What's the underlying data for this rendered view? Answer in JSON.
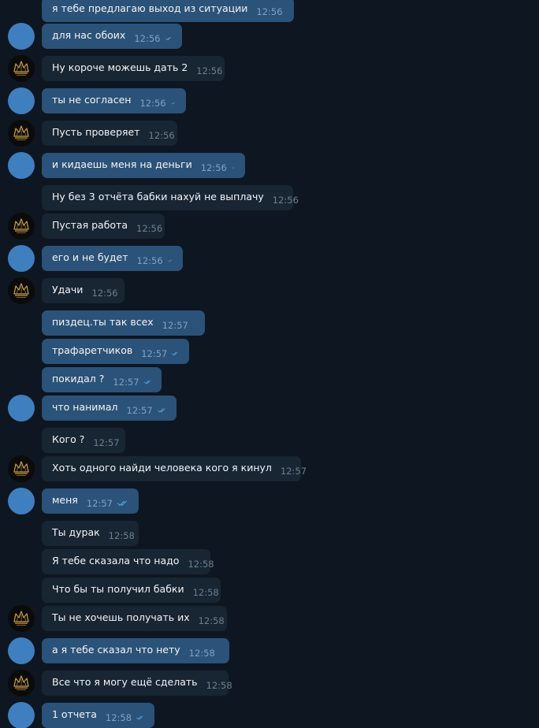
{
  "colors": {
    "background": "#0e1621",
    "outgoing_bubble": "#2b5278",
    "incoming_bubble": "#182533",
    "read_check": "#5ab3f0"
  },
  "messages": [
    {
      "text": "я тебе предлагаю выход из ситуации",
      "time": "12:56",
      "dir": "out",
      "avatar": false,
      "check": true
    },
    {
      "text": "для нас обоих",
      "time": "12:56",
      "dir": "out",
      "avatar": true,
      "check": true
    },
    {
      "text": "Ну короче можешь дать 2",
      "time": "12:56",
      "dir": "in",
      "avatar": true,
      "check": false
    },
    {
      "text": "ты не согласен",
      "time": "12:56",
      "dir": "out",
      "avatar": true,
      "check": true
    },
    {
      "text": "Пусть проверяет",
      "time": "12:56",
      "dir": "in",
      "avatar": true,
      "check": false
    },
    {
      "text": "и кидаешь меня на деньги",
      "time": "12:56",
      "dir": "out",
      "avatar": true,
      "check": true
    },
    {
      "text": "Ну без 3 отчёта бабки нахуй не выплачу",
      "time": "12:56",
      "dir": "in",
      "avatar": false,
      "check": false
    },
    {
      "text": "Пустая работа",
      "time": "12:56",
      "dir": "in",
      "avatar": true,
      "check": false
    },
    {
      "text": "его и не будет",
      "time": "12:56",
      "dir": "out",
      "avatar": true,
      "check": true
    },
    {
      "text": "Удачи",
      "time": "12:56",
      "dir": "in",
      "avatar": true,
      "check": false
    },
    {
      "text": "пиздец.ты так всех",
      "time": "12:57",
      "dir": "out",
      "avatar": false,
      "check": true
    },
    {
      "text": "трафаретчиков",
      "time": "12:57",
      "dir": "out",
      "avatar": false,
      "check": true
    },
    {
      "text": "покидал ?",
      "time": "12:57",
      "dir": "out",
      "avatar": false,
      "check": true
    },
    {
      "text": "что нанимал",
      "time": "12:57",
      "dir": "out",
      "avatar": true,
      "check": true
    },
    {
      "text": "Кого ?",
      "time": "12:57",
      "dir": "in",
      "avatar": false,
      "check": false
    },
    {
      "text": "Хоть одного найди человека кого я кинул",
      "time": "12:57",
      "dir": "in",
      "avatar": true,
      "check": false
    },
    {
      "text": "меня",
      "time": "12:57",
      "dir": "out",
      "avatar": true,
      "check": true
    },
    {
      "text": "Ты дурак",
      "time": "12:58",
      "dir": "in",
      "avatar": false,
      "check": false
    },
    {
      "text": "Я тебе сказала что надо",
      "time": "12:58",
      "dir": "in",
      "avatar": false,
      "check": false
    },
    {
      "text": "Что бы ты получил бабки",
      "time": "12:58",
      "dir": "in",
      "avatar": false,
      "check": false
    },
    {
      "text": "Ты не хочешь получать их",
      "time": "12:58",
      "dir": "in",
      "avatar": true,
      "check": false
    },
    {
      "text": "а я тебе сказал что нету",
      "time": "12:58",
      "dir": "out",
      "avatar": true,
      "check": true
    },
    {
      "text": "Все что я могу ещё сделать",
      "time": "12:58",
      "dir": "in",
      "avatar": true,
      "check": false
    },
    {
      "text": "1 отчета",
      "time": "12:58",
      "dir": "out",
      "avatar": true,
      "check": true
    }
  ]
}
